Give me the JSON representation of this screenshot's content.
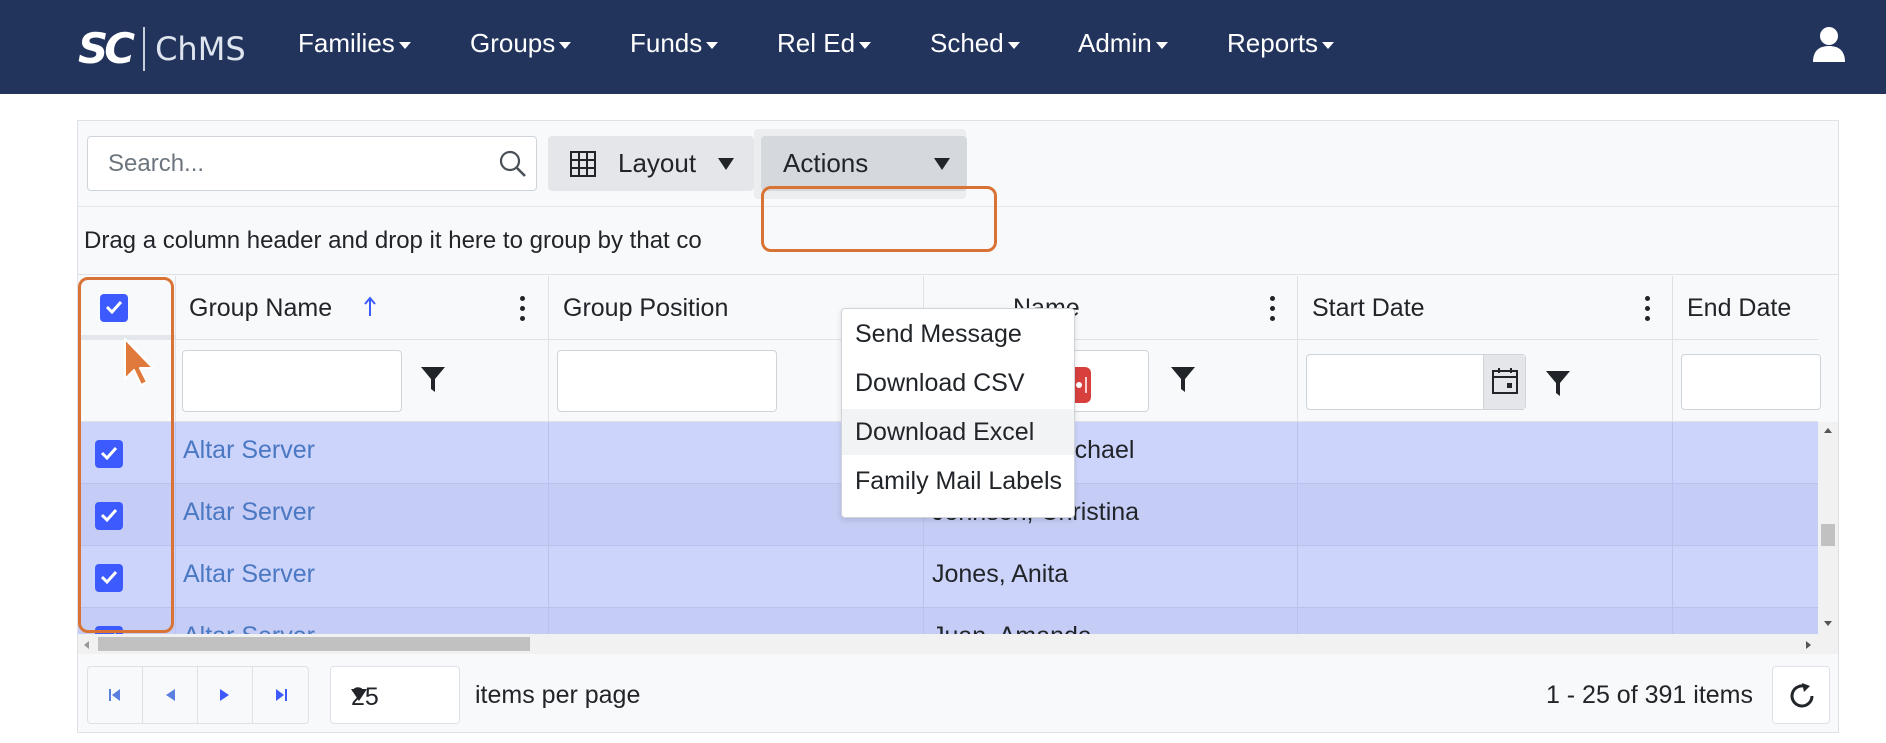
{
  "navbar": {
    "logo_mark": "SC",
    "logo_text": "ChMS",
    "menu": [
      {
        "label": "Families"
      },
      {
        "label": "Groups"
      },
      {
        "label": "Funds"
      },
      {
        "label": "Rel Ed"
      },
      {
        "label": "Sched"
      },
      {
        "label": "Admin"
      },
      {
        "label": "Reports"
      }
    ],
    "colors": {
      "navbar_bg": "#22335c",
      "accent": "#3d5afe",
      "highlight": "#d87335"
    }
  },
  "toolbar": {
    "search_placeholder": "Search...",
    "layout_label": "Layout",
    "actions_label": "Actions"
  },
  "actions_menu": {
    "items": [
      {
        "label": "Send Message",
        "highlighted": true
      },
      {
        "label": "Download CSV"
      },
      {
        "label": "Download Excel",
        "hover": true
      },
      {
        "label": "Family Mail Labels"
      }
    ]
  },
  "group_panel_text": "Drag a column header and drop it here to group by that co",
  "columns": [
    {
      "label": "Group Name",
      "sorted": "ascending"
    },
    {
      "label": "Group Position"
    },
    {
      "label": "Name"
    },
    {
      "label": "Start Date"
    },
    {
      "label": "End Date"
    }
  ],
  "rows": [
    {
      "group": "Altar Server",
      "position": "",
      "name": "Jefferson, Michael",
      "checked": true
    },
    {
      "group": "Altar Server",
      "position": "",
      "name": "Johnson, Christina",
      "checked": true
    },
    {
      "group": "Altar Server",
      "position": "",
      "name": "Jones, Anita",
      "checked": true
    },
    {
      "group": "Altar Server",
      "position": "",
      "name": "Juan, Amanda",
      "checked": true
    }
  ],
  "pager": {
    "page_size": "25",
    "items_per_page_label": "items per page",
    "summary": "1 - 25 of 391 items"
  },
  "icons": [
    "search-icon",
    "grid-icon",
    "filter-icon",
    "calendar-icon",
    "more-icon",
    "user-icon",
    "refresh-icon",
    "first-page-icon",
    "prev-page-icon",
    "next-page-icon",
    "last-page-icon",
    "sort-asc-icon",
    "kebab-icon",
    "cursor-icon"
  ]
}
